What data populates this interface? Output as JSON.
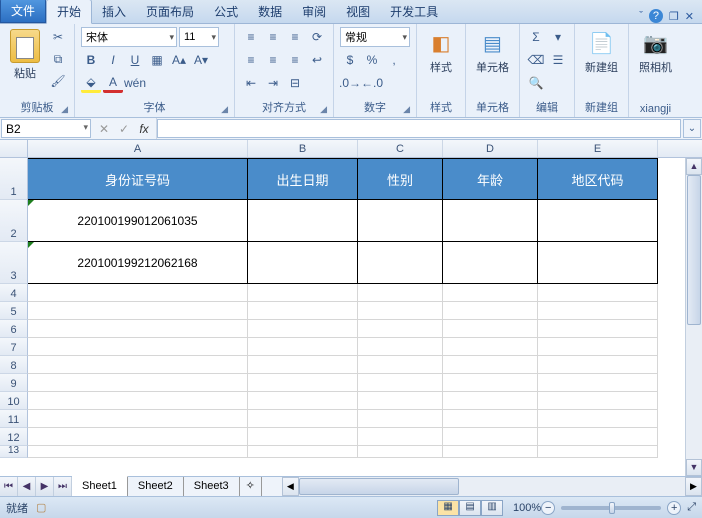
{
  "tabs": {
    "file": "文件",
    "home": "开始",
    "insert": "插入",
    "layout": "页面布局",
    "formula": "公式",
    "data": "数据",
    "review": "审阅",
    "view": "视图",
    "dev": "开发工具"
  },
  "ribbon": {
    "clipboard": {
      "paste": "粘贴",
      "label": "剪贴板"
    },
    "font": {
      "name": "宋体",
      "size": "11",
      "label": "字体"
    },
    "align": {
      "label": "对齐方式"
    },
    "number": {
      "format": "常规",
      "label": "数字"
    },
    "style": {
      "label": "样式",
      "btn": "样式"
    },
    "cells": {
      "label": "单元格",
      "btn": "单元格"
    },
    "edit": {
      "label": "编辑"
    },
    "new": {
      "label": "新建组",
      "btn": "新建组"
    },
    "camera": {
      "label": "xiangji",
      "btn": "照相机"
    }
  },
  "namebox": "B2",
  "cols": {
    "A": 220,
    "B": 110,
    "C": 85,
    "D": 95,
    "E": 120
  },
  "headers": {
    "A": "身份证号码",
    "B": "出生日期",
    "C": "性别",
    "D": "年龄",
    "E": "地区代码"
  },
  "data_rows": [
    {
      "A": "220100199012061035",
      "B": "",
      "C": "",
      "D": "",
      "E": ""
    },
    {
      "A": "220100199212062168",
      "B": "",
      "C": "",
      "D": "",
      "E": ""
    }
  ],
  "sheets": [
    "Sheet1",
    "Sheet2",
    "Sheet3"
  ],
  "status": {
    "ready": "就绪",
    "zoom": "100%"
  },
  "chart_data": {
    "type": "table",
    "columns": [
      "身份证号码",
      "出生日期",
      "性别",
      "年龄",
      "地区代码"
    ],
    "rows": [
      [
        "220100199012061035",
        "",
        "",
        "",
        ""
      ],
      [
        "220100199212062168",
        "",
        "",
        "",
        ""
      ]
    ]
  }
}
